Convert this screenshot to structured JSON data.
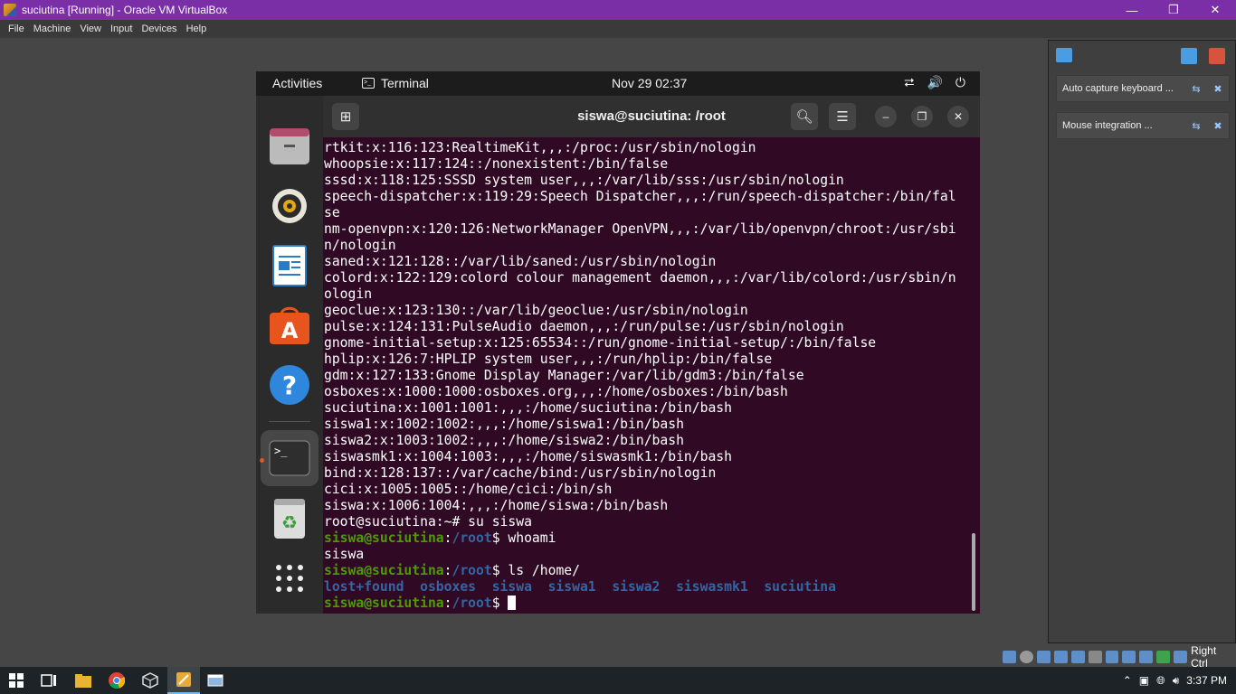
{
  "host_window": {
    "title": "suciutina [Running] - Oracle VM VirtualBox",
    "minimize_icon": "minimize-icon",
    "maximize_icon": "restore-icon",
    "close_icon": "close-icon",
    "menu": [
      "File",
      "Machine",
      "View",
      "Input",
      "Devices",
      "Help"
    ]
  },
  "guest": {
    "topbar": {
      "activities": "Activities",
      "app_name": "Terminal",
      "clock": "Nov 29  02:37"
    },
    "dock": {
      "items": [
        "files-icon",
        "rhythmbox-icon",
        "libreoffice-writer-icon",
        "ubuntu-software-icon",
        "help-icon",
        "terminal-icon",
        "trash-icon",
        "show-apps-icon"
      ],
      "terminal_glyph": ">_"
    },
    "terminal": {
      "title": "siswa@suciutina: /root",
      "lines": [
        {
          "t": "rtkit:x:116:123:RealtimeKit,,,:/proc:/usr/sbin/nologin"
        },
        {
          "t": "whoopsie:x:117:124::/nonexistent:/bin/false"
        },
        {
          "t": "sssd:x:118:125:SSSD system user,,,:/var/lib/sss:/usr/sbin/nologin"
        },
        {
          "t": "speech-dispatcher:x:119:29:Speech Dispatcher,,,:/run/speech-dispatcher:/bin/fal"
        },
        {
          "t": "se"
        },
        {
          "t": "nm-openvpn:x:120:126:NetworkManager OpenVPN,,,:/var/lib/openvpn/chroot:/usr/sbi"
        },
        {
          "t": "n/nologin"
        },
        {
          "t": "saned:x:121:128::/var/lib/saned:/usr/sbin/nologin"
        },
        {
          "t": "colord:x:122:129:colord colour management daemon,,,:/var/lib/colord:/usr/sbin/n"
        },
        {
          "t": "ologin"
        },
        {
          "t": "geoclue:x:123:130::/var/lib/geoclue:/usr/sbin/nologin"
        },
        {
          "t": "pulse:x:124:131:PulseAudio daemon,,,:/run/pulse:/usr/sbin/nologin"
        },
        {
          "t": "gnome-initial-setup:x:125:65534::/run/gnome-initial-setup/:/bin/false"
        },
        {
          "t": "hplip:x:126:7:HPLIP system user,,,:/run/hplip:/bin/false"
        },
        {
          "t": "gdm:x:127:133:Gnome Display Manager:/var/lib/gdm3:/bin/false"
        },
        {
          "t": "osboxes:x:1000:1000:osboxes.org,,,:/home/osboxes:/bin/bash"
        },
        {
          "t": "suciutina:x:1001:1001:,,,:/home/suciutina:/bin/bash"
        },
        {
          "t": "siswa1:x:1002:1002:,,,:/home/siswa1:/bin/bash"
        },
        {
          "t": "siswa2:x:1003:1002:,,,:/home/siswa2:/bin/bash"
        },
        {
          "t": "siswasmk1:x:1004:1003:,,,:/home/siswasmk1:/bin/bash"
        },
        {
          "t": "bind:x:128:137::/var/cache/bind:/usr/sbin/nologin"
        },
        {
          "t": "cici:x:1005:1005::/home/cici:/bin/sh"
        },
        {
          "t": "siswa:x:1006:1004:,,,:/home/siswa:/bin/bash"
        },
        {
          "t": "root@suciutina:~# su siswa"
        },
        {
          "user": "siswa@suciutina",
          "colon": ":",
          "path": "/root",
          "dollar": "$ ",
          "cmd": "whoami"
        },
        {
          "t": "siswa"
        },
        {
          "user": "siswa@suciutina",
          "colon": ":",
          "path": "/root",
          "dollar": "$ ",
          "cmd": "ls /home/"
        },
        {
          "dirs": "lost+found  osboxes  siswa  siswa1  siswa2  siswasmk1  suciutina"
        },
        {
          "user": "siswa@suciutina",
          "colon": ":",
          "path": "/root",
          "dollar": "$ ",
          "cmd": "",
          "cursor": true
        }
      ]
    }
  },
  "side_panel": {
    "notifications": [
      {
        "label": "Auto capture keyboard ..."
      },
      {
        "label": "Mouse integration ..."
      }
    ]
  },
  "status_bar": {
    "host_key": "Right Ctrl"
  },
  "taskbar": {
    "items": [
      "windows-start-icon",
      "task-view-icon",
      "file-explorer-icon",
      "chrome-icon",
      "virtualbox-icon",
      "virtualbox-vm-icon",
      "window-icon"
    ],
    "time": "3:37 PM"
  },
  "colors": {
    "vbox_titlebar": "#7a2fa6",
    "terminal_bg": "#300a24",
    "prompt_user": "#4e9a06",
    "prompt_path": "#3465a4"
  }
}
